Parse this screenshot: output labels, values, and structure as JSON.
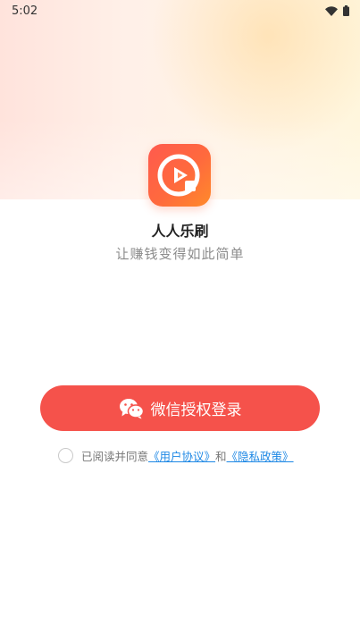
{
  "status_bar": {
    "time": "5:02"
  },
  "app": {
    "name": "人人乐刷",
    "slogan": "让赚钱变得如此简单"
  },
  "login": {
    "button_label": "微信授权登录"
  },
  "agreement": {
    "prefix": "已阅读并同意",
    "user_agreement": "《用户协议》",
    "conjunction": "和",
    "privacy_policy": "《隐私政策》"
  },
  "colors": {
    "accent": "#f5524b",
    "link": "#1e88e5",
    "icon_gradient_start": "#ff5a4e",
    "icon_gradient_end": "#ff8a2a"
  },
  "icons": {
    "status": [
      "wifi-icon",
      "battery-icon"
    ],
    "app": "app-play-icon",
    "button": "wechat-icon"
  }
}
